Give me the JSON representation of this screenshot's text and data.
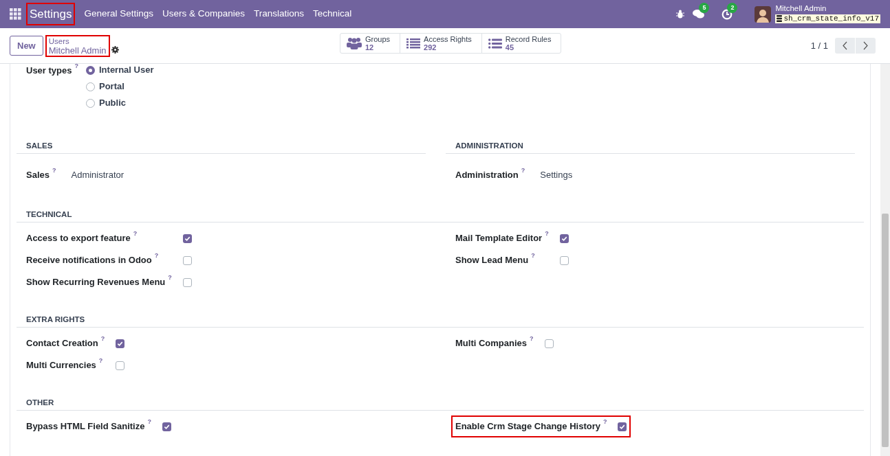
{
  "navbar": {
    "app": {
      "label": "Settings",
      "highlighted": true
    },
    "menus": [
      "General Settings",
      "Users & Companies",
      "Translations",
      "Technical"
    ],
    "messages_badge": "5",
    "activities_badge": "2",
    "user_name": "Mitchell Admin",
    "database": "sh_crm_state_info_v17"
  },
  "control_panel": {
    "new_button": "New",
    "breadcrumb": {
      "parent": "Users",
      "current": "Mitchell Admin",
      "highlighted": true
    },
    "stat_buttons": [
      {
        "kind": "groups",
        "label": "Groups",
        "value": "12"
      },
      {
        "kind": "list",
        "label": "Access Rights",
        "value": "292"
      },
      {
        "kind": "bullets",
        "label": "Record Rules",
        "value": "45"
      }
    ],
    "pager": "1 / 1"
  },
  "user_types": {
    "label": "User types",
    "help": "?",
    "options": [
      {
        "label": "Internal User",
        "selected": true
      },
      {
        "label": "Portal",
        "selected": false
      },
      {
        "label": "Public",
        "selected": false
      }
    ]
  },
  "sections": [
    {
      "kind": "split",
      "columns": [
        {
          "title": "SALES",
          "fields": [
            {
              "label": "Sales",
              "help": "?",
              "value": "Administrator"
            }
          ]
        },
        {
          "title": "ADMINISTRATION",
          "fields": [
            {
              "label": "Administration",
              "help": "?",
              "value": "Settings"
            }
          ]
        }
      ]
    },
    {
      "kind": "checks",
      "title": "TECHNICAL",
      "columns": [
        [
          {
            "label": "Access to export feature",
            "help": "?",
            "checked": true,
            "highlighted": false
          },
          {
            "label": "Receive notifications in Odoo",
            "help": "?",
            "checked": false,
            "highlighted": false
          },
          {
            "label": "Show Recurring Revenues Menu",
            "help": "?",
            "checked": false,
            "highlighted": false
          }
        ],
        [
          {
            "label": "Mail Template Editor",
            "help": "?",
            "checked": true,
            "highlighted": false
          },
          {
            "label": "Show Lead Menu",
            "help": "?",
            "checked": false,
            "highlighted": false
          }
        ]
      ]
    },
    {
      "kind": "checks",
      "title": "EXTRA RIGHTS",
      "columns": [
        [
          {
            "label": "Contact Creation",
            "help": "?",
            "checked": true,
            "highlighted": false
          },
          {
            "label": "Multi Currencies",
            "help": "?",
            "checked": false,
            "highlighted": false
          }
        ],
        [
          {
            "label": "Multi Companies",
            "help": "?",
            "checked": false,
            "highlighted": false
          }
        ]
      ]
    },
    {
      "kind": "checks",
      "title": "OTHER",
      "columns": [
        [
          {
            "label": "Bypass HTML Field Sanitize",
            "help": "?",
            "checked": true,
            "highlighted": false
          }
        ],
        [
          {
            "label": "Enable Crm Stage Change History",
            "help": "?",
            "checked": true,
            "highlighted": true
          }
        ]
      ]
    }
  ]
}
